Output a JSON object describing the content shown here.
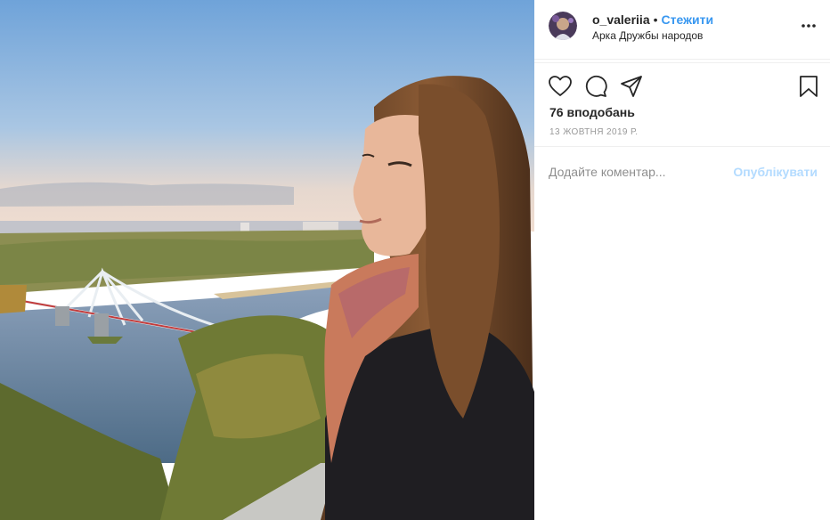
{
  "post": {
    "photo_alt": "Фото користувача o_valeriia",
    "username": "o_valeriia",
    "separator": "•",
    "follow_label": "Стежити",
    "location": "Арка Дружбы народов",
    "likes": "76 вподобань",
    "date": "13 ЖОВТНЯ 2019 Р."
  },
  "comment": {
    "placeholder": "Додайте коментар...",
    "publish_label": "Опублікувати"
  },
  "icons": {
    "more": "more-options-icon",
    "like": "heart-icon",
    "comment": "comment-icon",
    "share": "share-icon",
    "save": "bookmark-icon"
  },
  "colors": {
    "accent": "#3897f0",
    "publish_disabled": "#b3dbff",
    "text": "#262626",
    "muted": "#999999"
  }
}
